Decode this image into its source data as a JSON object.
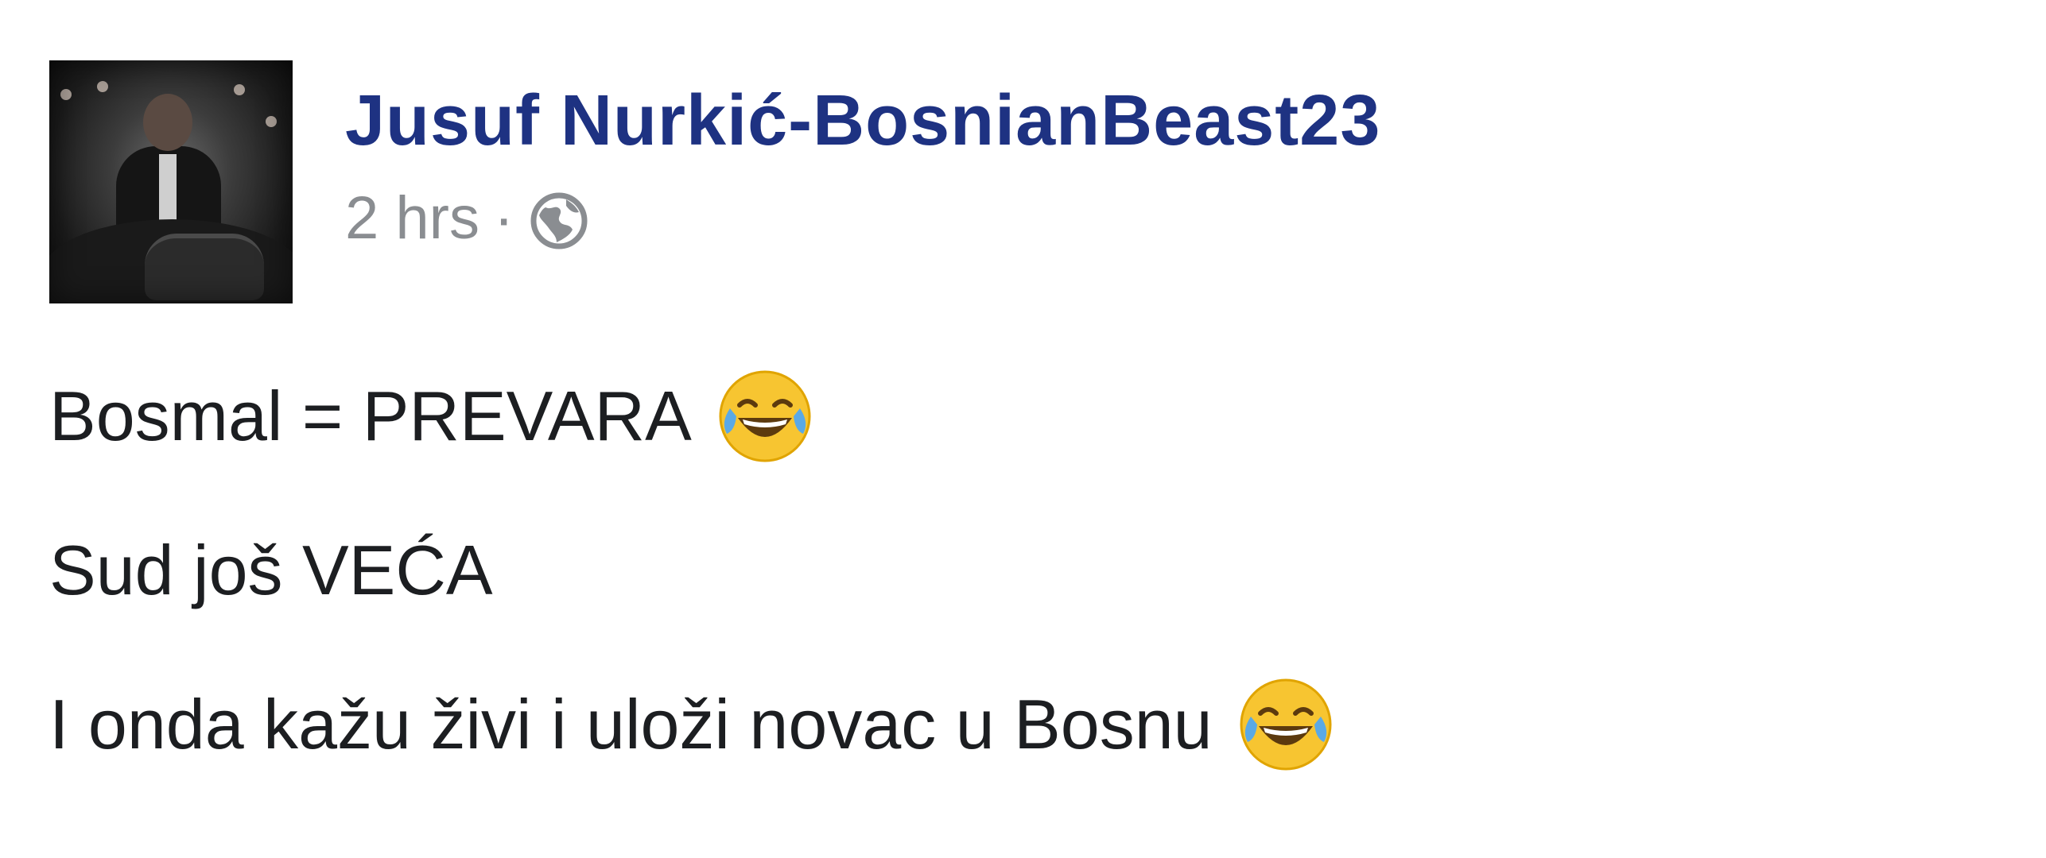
{
  "post": {
    "author": "Jusuf Nurkić-BosnianBeast23",
    "time": "2 hrs",
    "separator": "·",
    "privacy_icon": "globe-icon",
    "lines": [
      {
        "text": "Bosmal = PREVARA",
        "emoji": "face-with-tears-of-joy"
      },
      {
        "text": "Sud još VEĆA",
        "emoji": ""
      },
      {
        "text": "I onda kažu živi i uloži novac u Bosnu",
        "emoji": "face-with-tears-of-joy"
      }
    ]
  }
}
